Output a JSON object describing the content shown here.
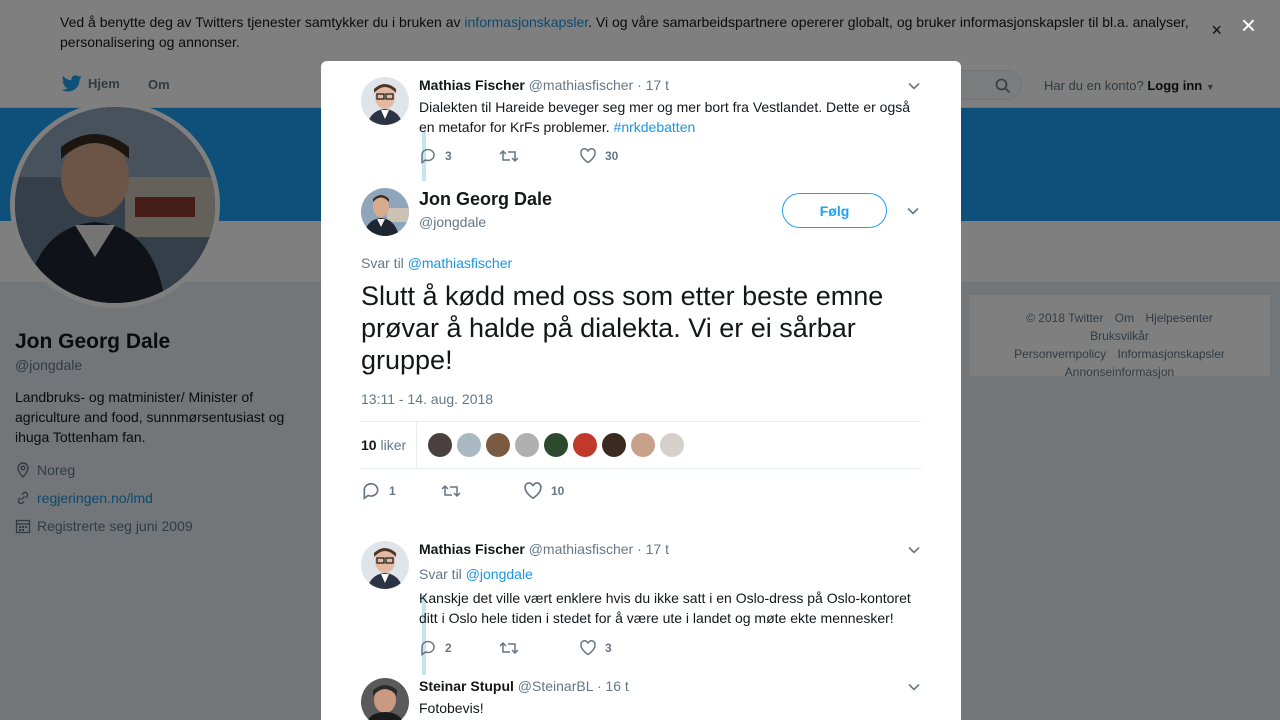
{
  "cookie": {
    "text_before": "Ved å benytte deg av Twitters tjenester samtykker du i bruken av ",
    "link": "informasjonskapsler",
    "text_after": ". Vi og våre samarbeidspartnere opererer globalt, og bruker informasjonskapsler til bl.a. analyser, personalisering og annonser.",
    "close": "×"
  },
  "nav": {
    "home": "Hjem",
    "about": "Om",
    "account_question": "Har du en konto?",
    "login": "Logg inn"
  },
  "profile": {
    "name": "Jon Georg Dale",
    "handle": "@jongdale",
    "bio": "Landbruks- og matminister/ Minister of agriculture and food, sunnmørsentusiast og ihuga Tottenham fan.",
    "location": "Noreg",
    "website": "regjeringen.no/lmd",
    "joined": "Registrerte seg juni 2009"
  },
  "footer": {
    "items": [
      "© 2018 Twitter",
      "Om",
      "Hjelpesenter",
      "Bruksvilkår",
      "Personvernpolicy",
      "Informasjonskapsler",
      "Annonseinformasjon"
    ]
  },
  "overlay": {
    "close": "×"
  },
  "parent_tweet": {
    "name": "Mathias Fischer",
    "handle": "@mathiasfischer",
    "time": "· 17 t",
    "text": "Dialekten til Hareide beveger seg mer og mer bort fra Vestlandet. Dette er også en metafor for KrFs problemer.",
    "hashtag": "#nrkdebatten",
    "replies": "3",
    "likes": "30"
  },
  "main_tweet": {
    "name": "Jon Georg Dale",
    "handle": "@jongdale",
    "follow": "Følg",
    "reply_label": "Svar til",
    "reply_to": "@mathiasfischer",
    "text": "Slutt å kødd med oss som etter beste emne prøvar å halde på dialekta. Vi er ei sårbar gruppe!",
    "time": "13:11 - 14. aug. 2018",
    "like_count": "10",
    "like_label": "liker",
    "replies": "1",
    "likes": "10"
  },
  "reply_tweet": {
    "name": "Mathias Fischer",
    "handle": "@mathiasfischer",
    "time": "· 17 t",
    "reply_label": "Svar til",
    "reply_to": "@jongdale",
    "text": "Kanskje det ville vært enklere hvis du ikke satt i en Oslo-dress på Oslo-kontoret ditt i Oslo hele tiden i stedet for å være ute i landet og møte ekte mennesker!",
    "replies": "2",
    "likes": "3"
  },
  "reply_tweet2": {
    "name": "Steinar Stupul",
    "handle": "@SteinarBL",
    "time": "· 16 t",
    "text": "Fotobevis!"
  },
  "colors": {
    "accent": "#1da1f2",
    "link": "#1b95e0",
    "muted": "#657786"
  }
}
